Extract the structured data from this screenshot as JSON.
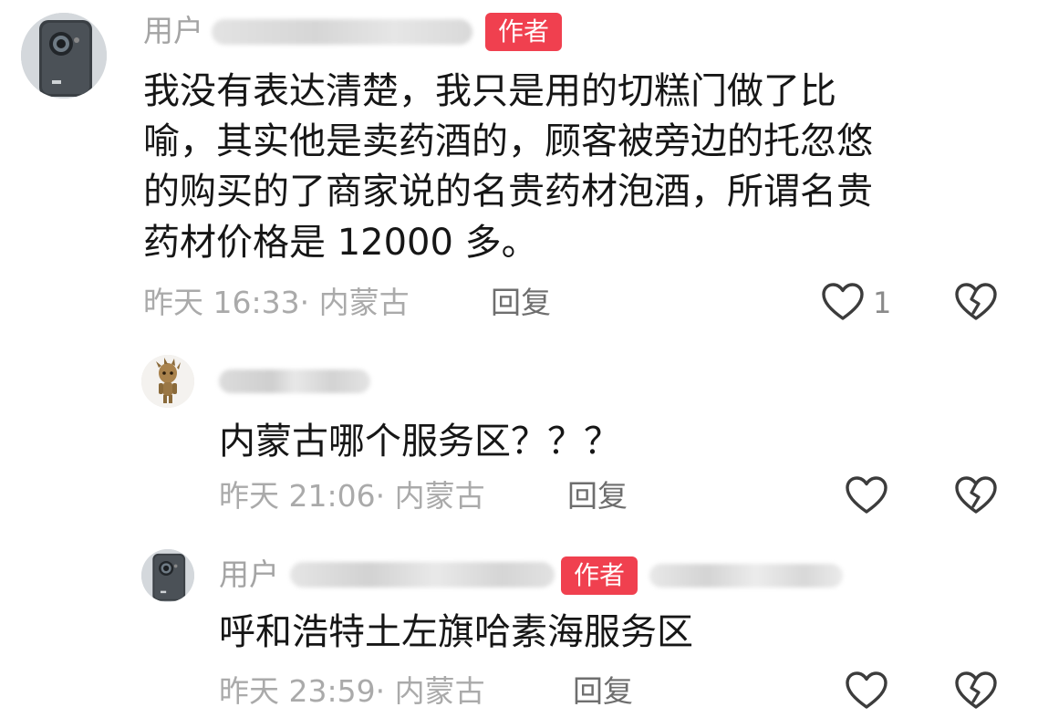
{
  "comments": [
    {
      "user_prefix": "用户",
      "badge": "作者",
      "lines": [
        "我没有表达清楚，我只是用的切糕门做了比",
        "喻，其实他是卖药酒的，顾客被旁边的托忽悠",
        "的购买的了商家说的名贵药材泡酒，所谓名贵",
        "药材价格是 12000 多。"
      ],
      "meta": "昨天 16:33· 内蒙古",
      "reply_label": "回复",
      "like_count": "1",
      "icons": {
        "avatar": "phone-avatar-icon",
        "like": "heart-outline-icon",
        "dislike": "broken-heart-icon"
      }
    }
  ],
  "replies": [
    {
      "text": "内蒙古哪个服务区？？？",
      "meta": "昨天 21:06· 内蒙古",
      "reply_label": "回复",
      "icons": {
        "avatar": "groot-avatar-icon",
        "like": "heart-outline-icon",
        "dislike": "broken-heart-icon"
      }
    },
    {
      "user_prefix": "用户",
      "badge": "作者",
      "text": "呼和浩特土左旗哈素海服务区",
      "meta": "昨天 23:59· 内蒙古",
      "reply_label": "回复",
      "icons": {
        "avatar": "phone-avatar-icon",
        "like": "heart-outline-icon",
        "dislike": "broken-heart-icon"
      }
    }
  ],
  "colors": {
    "badge_bg": "#f0404f",
    "meta_text": "#aaaaaa",
    "body_text": "#161616"
  }
}
